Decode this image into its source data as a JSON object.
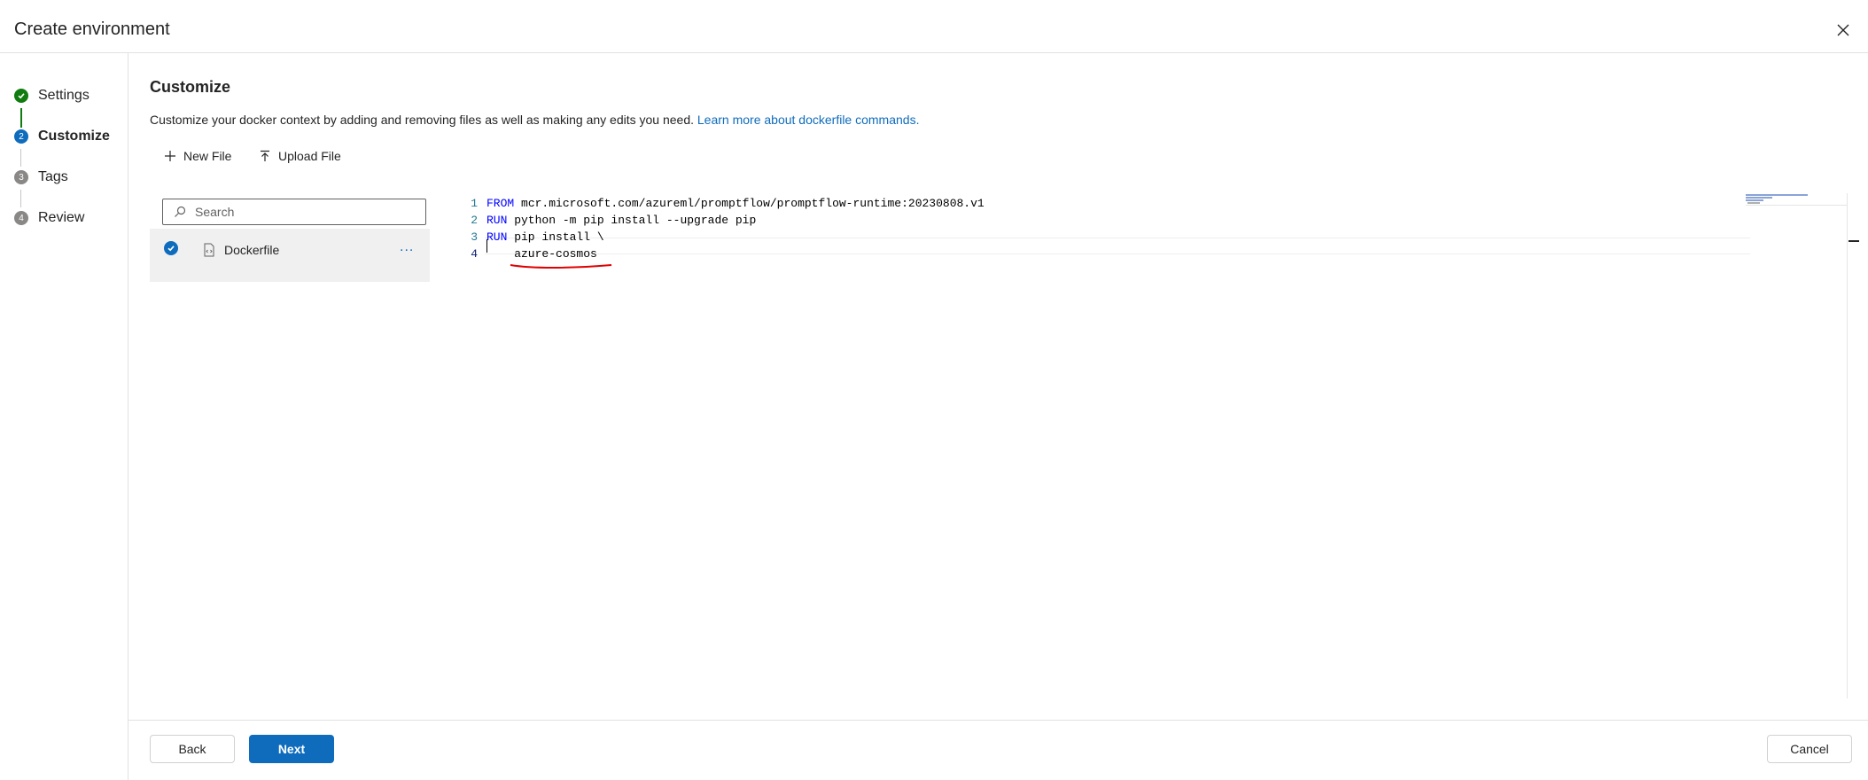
{
  "dialog": {
    "title": "Create environment"
  },
  "steps": [
    {
      "label": "Settings",
      "number": "1",
      "state": "completed"
    },
    {
      "label": "Customize",
      "number": "2",
      "state": "active"
    },
    {
      "label": "Tags",
      "number": "3",
      "state": "pending"
    },
    {
      "label": "Review",
      "number": "4",
      "state": "pending"
    }
  ],
  "customize": {
    "heading": "Customize",
    "description": "Customize your docker context by adding and removing files as well as making any edits you need.",
    "learn_more_link": "Learn more about dockerfile commands.",
    "new_file_label": "New File",
    "upload_file_label": "Upload File"
  },
  "file_pane": {
    "search_placeholder": "Search",
    "files": [
      {
        "name": "Dockerfile",
        "selected": true,
        "more_label": "..."
      }
    ]
  },
  "editor": {
    "lines": [
      {
        "number": "1",
        "keyword": "FROM",
        "rest": " mcr.microsoft.com/azureml/promptflow/promptflow-runtime:20230808.v1"
      },
      {
        "number": "2",
        "keyword": "RUN",
        "rest": " python -m pip install --upgrade pip"
      },
      {
        "number": "3",
        "keyword": "RUN",
        "rest": " pip install \\"
      },
      {
        "number": "4",
        "keyword": "",
        "rest": "    azure-cosmos"
      }
    ],
    "current_line": "4"
  },
  "footer": {
    "back_label": "Back",
    "next_label": "Next",
    "cancel_label": "Cancel"
  },
  "colors": {
    "accent": "#0f6cbd",
    "success": "#107c10",
    "annotation": "#e00000",
    "pending": "#8a8886"
  }
}
